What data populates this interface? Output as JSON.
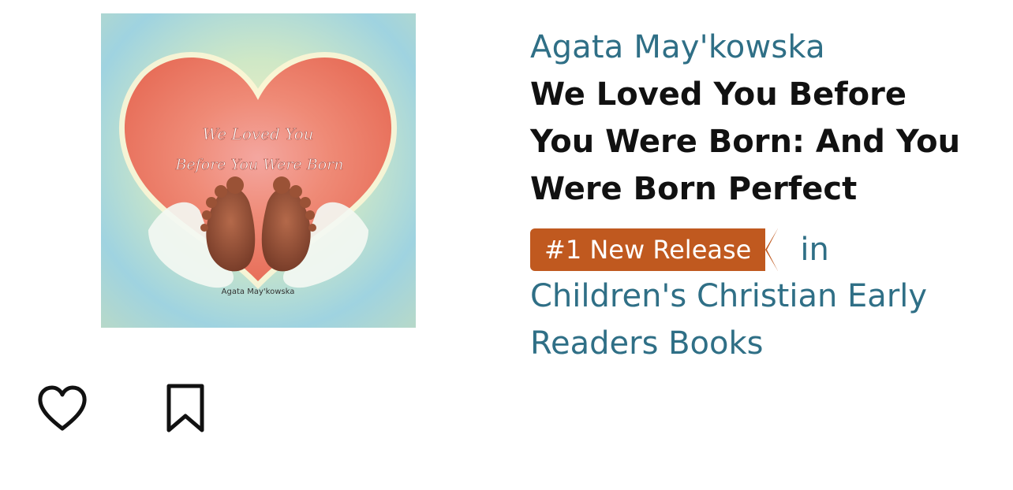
{
  "book": {
    "author": "Agata May'kowska",
    "title": "We Loved You Before You Were Born: And You Were Born Perfect",
    "rank_badge": "#1 New Release",
    "rank_connector": "in",
    "category": "Children's Christian Early Readers Books"
  },
  "cover": {
    "title_line_1": "We Loved You",
    "title_line_2": "Before You Were Born",
    "author": "Agata May'kowska"
  },
  "actions": {
    "like_icon": "heart-outline-icon",
    "save_icon": "bookmark-outline-icon"
  },
  "colors": {
    "link": "#2f6f86",
    "badge": "#c0591f",
    "title": "#111111"
  }
}
